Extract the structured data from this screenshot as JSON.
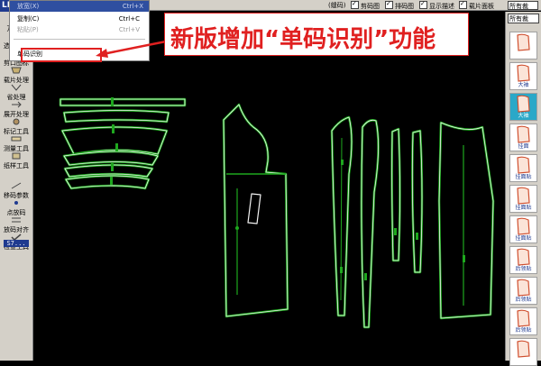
{
  "app": {
    "logo": "LIKE"
  },
  "left_toolbar": {
    "tools": [
      {
        "label": "万能笔",
        "icon": "universal-pen-icon"
      },
      {
        "label": "选择工具",
        "icon": "select-tool-icon"
      },
      {
        "label": "剪口图标",
        "icon": "notch-icon"
      },
      {
        "label": "载片处理",
        "icon": "piece-process-icon"
      },
      {
        "label": "省处理",
        "icon": "dart-icon"
      },
      {
        "label": "展开处理",
        "icon": "spread-icon"
      },
      {
        "label": "标记工具",
        "icon": "mark-tool-icon"
      },
      {
        "label": "测量工具",
        "icon": "measure-tool-icon"
      },
      {
        "label": "纸样工具",
        "icon": "pattern-tool-icon"
      },
      {
        "label": "移码参数",
        "icon": "grading-param-icon"
      },
      {
        "label": "点放码",
        "icon": "point-grading-icon"
      },
      {
        "label": "放码对齐",
        "icon": "grading-align-icon"
      },
      {
        "label": "检查工具",
        "icon": "check-tool-icon"
      }
    ],
    "counter": "S7..."
  },
  "menu": {
    "top_item": "放宽(X)",
    "top_shortcut": "Ctrl+X",
    "items": [
      {
        "label": "复制(C)",
        "shortcut": "Ctrl+C",
        "state": "normal"
      },
      {
        "label": "粘贴(P)",
        "shortcut": "Ctrl+V",
        "state": "greyed"
      }
    ],
    "highlighted_item": "单码识别"
  },
  "annotation": {
    "text": "新版增加“单码识别”功能",
    "color": "#e02020"
  },
  "top_bar": {
    "checks": [
      "(缝码)",
      "剪码图",
      "排码图",
      "显示描述",
      "载片面板"
    ],
    "select_value": "所有裁"
  },
  "right_panel": {
    "select_value": "所有裁",
    "pieces": [
      {
        "label": ""
      },
      {
        "label": "大袖",
        "selected": false
      },
      {
        "label": "大袖",
        "selected": true
      },
      {
        "label": "挂面",
        "selected": false
      },
      {
        "label": "挂面贴",
        "selected": false
      },
      {
        "label": "挂面贴",
        "selected": false
      },
      {
        "label": "挂面贴",
        "selected": false
      },
      {
        "label": "后领贴",
        "selected": false
      },
      {
        "label": "后领贴",
        "selected": false
      },
      {
        "label": "后领贴",
        "selected": false
      },
      {
        "label": "",
        "selected": false
      }
    ]
  },
  "colors": {
    "canvas_bg": "#000000",
    "pattern_outline": "#1ea81e",
    "pattern_inner": "#f2f2f2",
    "toolbar_bg": "#d4d0c8",
    "selected_piece": "#2aa8c8"
  }
}
